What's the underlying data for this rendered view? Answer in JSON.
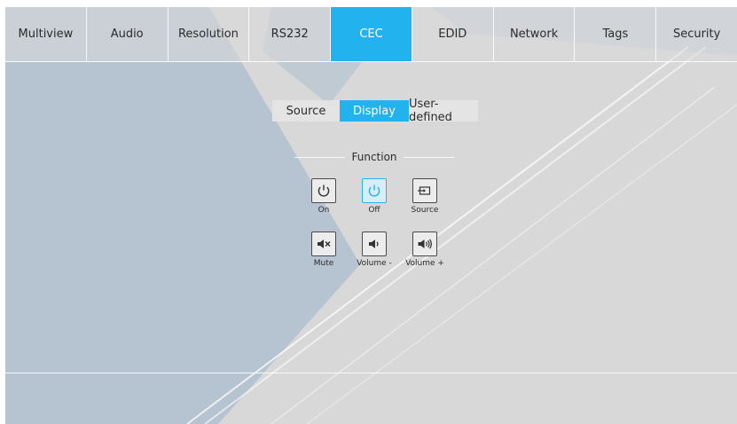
{
  "tabs": {
    "multiview": "Multiview",
    "audio": "Audio",
    "resolution": "Resolution",
    "rs232": "RS232",
    "cec": "CEC",
    "edid": "EDID",
    "network": "Network",
    "tags": "Tags",
    "security": "Security",
    "active": "CEC"
  },
  "subtabs": {
    "source": "Source",
    "display": "Display",
    "user_defined": "User-defined",
    "active": "Display"
  },
  "function": {
    "heading": "Function",
    "buttons": {
      "on": "On",
      "off": "Off",
      "source": "Source",
      "mute": "Mute",
      "volume_down": "Volume -",
      "volume_up": "Volume +"
    },
    "selected": "Off"
  },
  "icons": {
    "on": "power-icon",
    "off": "power-icon",
    "source": "input-source-icon",
    "mute": "mute-icon",
    "volume_down": "volume-down-icon",
    "volume_up": "volume-up-icon"
  },
  "colors": {
    "accent": "#22b2ee",
    "background": "#d8d8d8",
    "watermark": "#6d9cc0"
  }
}
